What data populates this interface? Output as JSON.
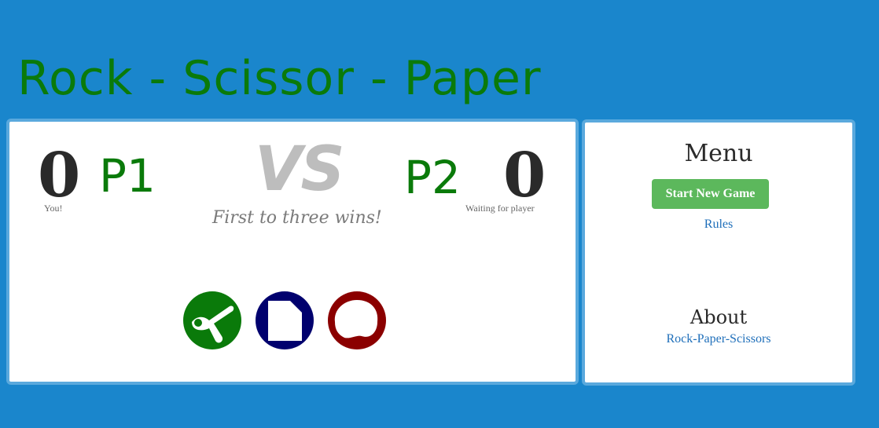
{
  "header": {
    "title": "Rock - Scissor - Paper"
  },
  "game": {
    "player1": {
      "score": "0",
      "label": "P1",
      "status": "You!"
    },
    "player2": {
      "score": "0",
      "label": "P2",
      "status": "Waiting for player"
    },
    "vs_text": "VS",
    "subtitle": "First to three wins!",
    "choices": [
      {
        "name": "scissors",
        "color": "#0a7a0a"
      },
      {
        "name": "paper",
        "color": "#00006e"
      },
      {
        "name": "rock",
        "color": "#8b0000"
      }
    ]
  },
  "menu": {
    "title": "Menu",
    "start_button": "Start New Game",
    "rules_link": "Rules",
    "about_title": "About",
    "about_link": "Rock-Paper-Scissors"
  }
}
